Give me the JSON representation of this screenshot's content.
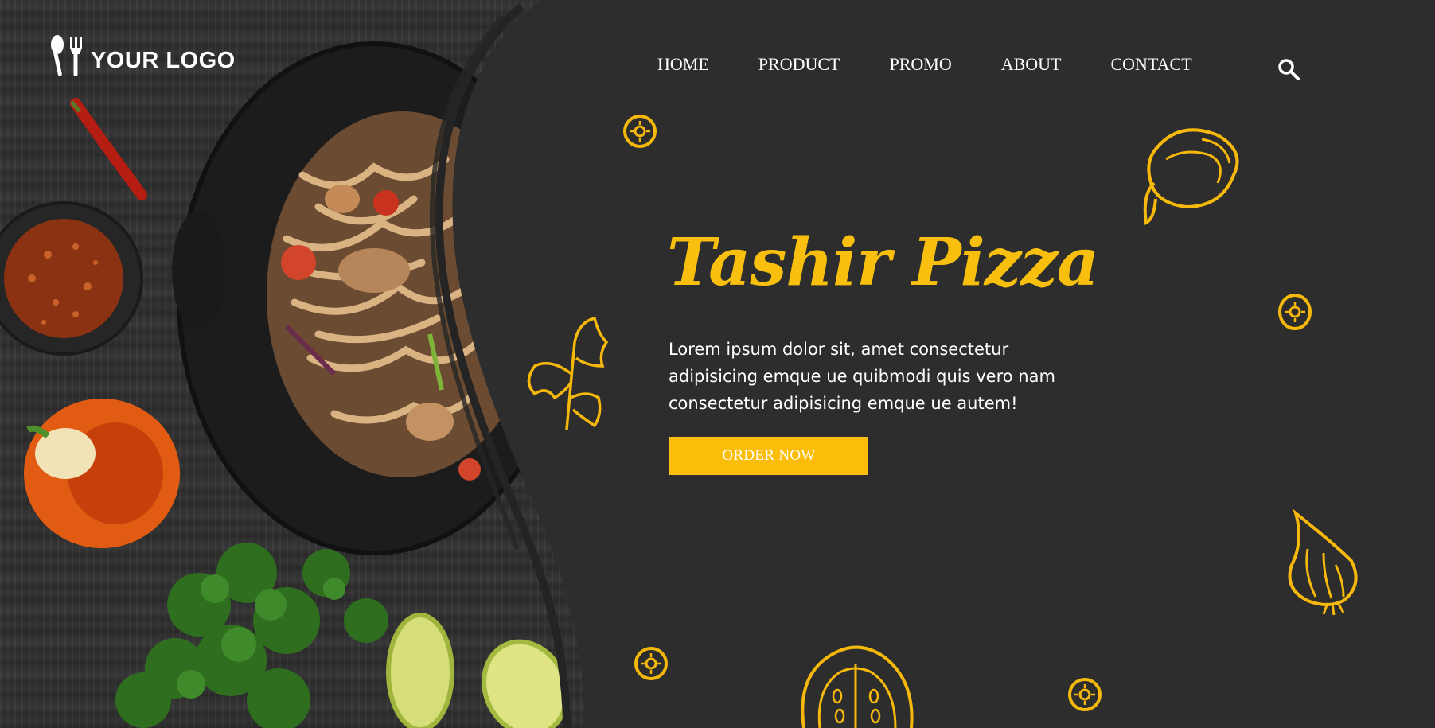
{
  "brand": {
    "logo_text": "YOUR LOGO",
    "logo_icon": "spoon-fork-icon"
  },
  "nav": {
    "items": [
      {
        "label": "HOME"
      },
      {
        "label": "PRODUCT"
      },
      {
        "label": "PROMO"
      },
      {
        "label": "ABOUT"
      },
      {
        "label": "CONTACT"
      }
    ],
    "search_icon": "search-icon"
  },
  "hero": {
    "title": "Tashir Pizza",
    "description": "Lorem ipsum dolor sit, amet consectetur adipisicing emque ue quibmodi quis vero nam consectetur adipisicing emque ue autem!",
    "cta_label": "ORDER NOW"
  },
  "colors": {
    "accent": "#fbbd08",
    "background": "#2d2d2d",
    "text": "#ffffff"
  }
}
